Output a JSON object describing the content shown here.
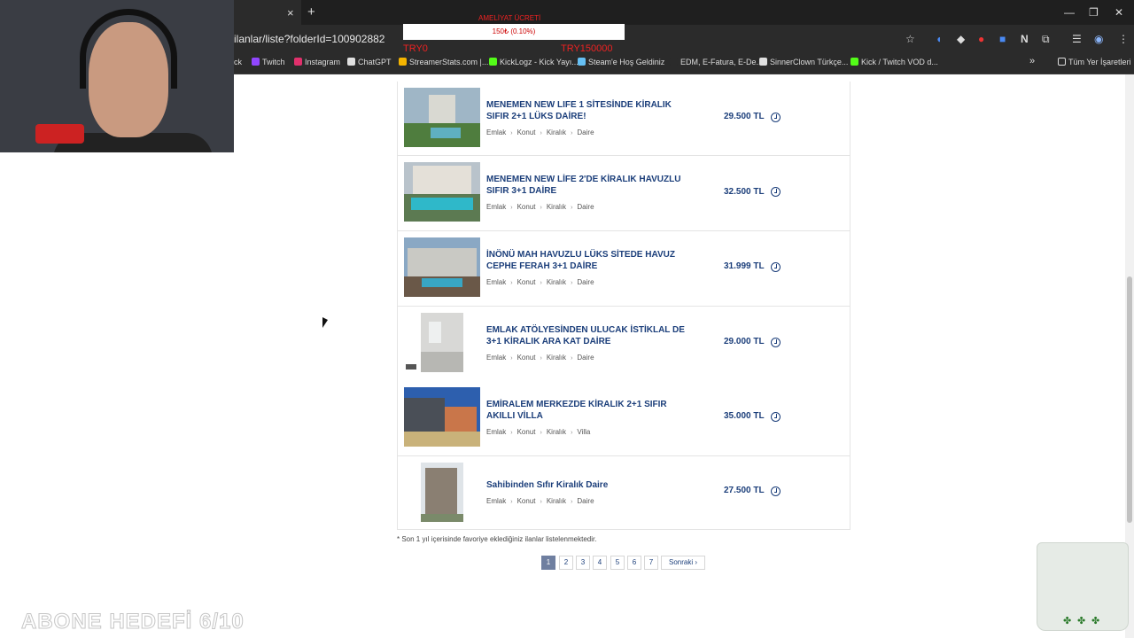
{
  "browser": {
    "tab_close": "×",
    "new_tab": "+",
    "url": "ilanlar/liste?folderId=100902882",
    "window_controls": [
      "—",
      "❐",
      "✕"
    ],
    "bookmarks": [
      {
        "label": "ck",
        "color": "#2b2b2b"
      },
      {
        "label": "Twitch",
        "color": "#9146ff"
      },
      {
        "label": "Instagram",
        "color": "#e1306c"
      },
      {
        "label": "ChatGPT",
        "color": "#e0e0e0"
      },
      {
        "label": "StreamerStats.com |...",
        "color": "#f4b400"
      },
      {
        "label": "KickLogz - Kick Yayı...",
        "color": "#53fc18"
      },
      {
        "label": "Steam'e Hoş Geldiniz",
        "color": "#66c0f4"
      },
      {
        "label": "EDM, E-Fatura, E-De...",
        "color": "#2b2b2b"
      },
      {
        "label": "SinnerClown Türkçe...",
        "color": "#e0e0e0"
      },
      {
        "label": "Kick / Twitch VOD d...",
        "color": "#53fc18"
      }
    ],
    "bookmarks_overflow": "»",
    "all_bookmarks": "Tüm Yer İşaretleri"
  },
  "stream_overlay": {
    "title": "AMELİYAT ÜCRETİ",
    "progress_text": "150₺ (0.10%)",
    "left_label": "TRY0",
    "right_label": "TRY150000",
    "goal_text": "ABONE HEDEFİ 6/10"
  },
  "listings": [
    {
      "title": "MENEMEN NEW LIFE 1 SİTESİNDE KİRALIK SIFIR 2+1 LÜKS DAİRE!",
      "crumbs": [
        "Emlak",
        "Konut",
        "Kiralık",
        "Daire"
      ],
      "price": "29.500 TL"
    },
    {
      "title": "MENEMEN NEW LİFE 2'DE KİRALIK HAVUZLU SIFIR 3+1 DAİRE",
      "crumbs": [
        "Emlak",
        "Konut",
        "Kiralık",
        "Daire"
      ],
      "price": "32.500 TL"
    },
    {
      "title": "İNÖNÜ MAH HAVUZLU LÜKS SİTEDE HAVUZ CEPHE FERAH 3+1 DAİRE",
      "crumbs": [
        "Emlak",
        "Konut",
        "Kiralık",
        "Daire"
      ],
      "price": "31.999 TL"
    },
    {
      "title": "EMLAK ATÖLYESİNDEN ULUCAK İSTİKLAL DE 3+1 KİRALIK ARA KAT DAİRE",
      "crumbs": [
        "Emlak",
        "Konut",
        "Kiralık",
        "Daire"
      ],
      "price": "29.000 TL"
    },
    {
      "title": "EMİRALEM MERKEZDE KİRALIK 2+1 SIFIR AKILLI VİLLA",
      "crumbs": [
        "Emlak",
        "Konut",
        "Kiralık",
        "Villa"
      ],
      "price": "35.000 TL"
    },
    {
      "title": "Sahibinden Sıfır Kiralık Daire",
      "crumbs": [
        "Emlak",
        "Konut",
        "Kiralık",
        "Daire"
      ],
      "price": "27.500 TL"
    }
  ],
  "footnote": "* Son 1 yıl içerisinde favoriye eklediğiniz ilanlar listelenmektedir.",
  "pagination": {
    "pages": [
      "1",
      "2",
      "3",
      "4",
      "5",
      "6",
      "7"
    ],
    "current": "1",
    "next_label": "Sonraki ›"
  },
  "colors": {
    "link": "#1b3e7a",
    "active_page": "#6f7fa0"
  }
}
